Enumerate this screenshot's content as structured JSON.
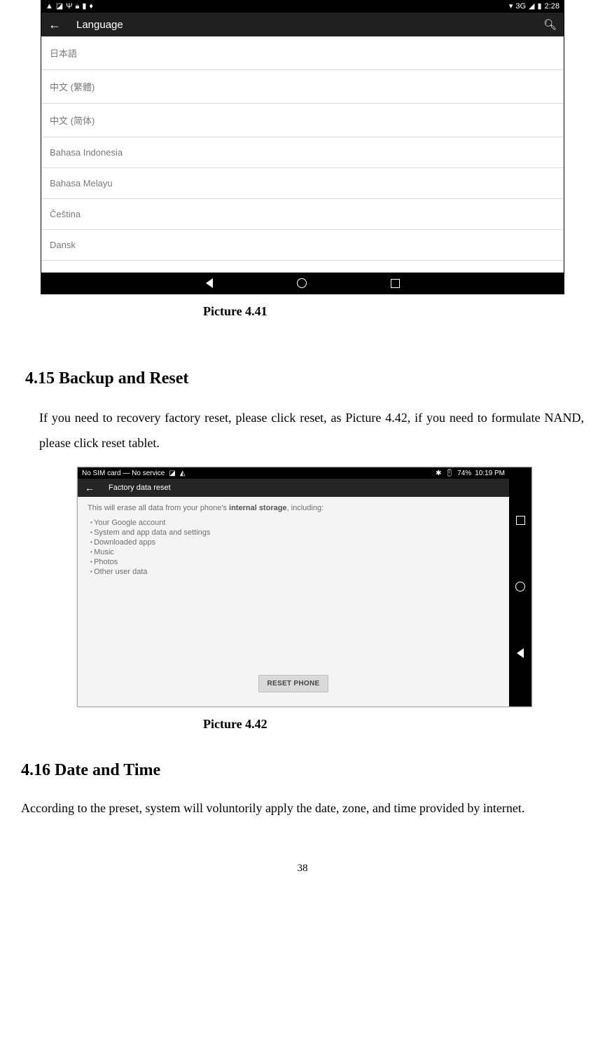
{
  "shot1": {
    "statusbar": {
      "left_icons": [
        "▲",
        "◪",
        "⊍",
        "🔒",
        "≡",
        "♦"
      ],
      "right_text": "3G ◢ ⚡ 2:28",
      "signal_label": "3G"
    },
    "appbar": {
      "title": "Language"
    },
    "languages": [
      "日本語",
      "中文 (繁體)",
      "中文 (简体)",
      "Bahasa Indonesia",
      "Bahasa Melayu",
      "Čeština",
      "Dansk"
    ],
    "peek": ""
  },
  "caption1": "Picture 4.41",
  "section415": {
    "heading": "4.15  Backup and Reset",
    "body": "If you need to recovery factory reset, please click reset, as Picture 4.42, if you need to formulate NAND, please click reset tablet."
  },
  "shot2": {
    "statusbar": {
      "left": "No SIM card — No service",
      "right": "✱  🔋 74%  10:19 PM",
      "battery": "74%",
      "time": "10:19 PM"
    },
    "appbar": {
      "title": "Factory data reset"
    },
    "intro_pre": "This will erase all data from your phone's ",
    "intro_strong": "internal storage",
    "intro_post": ", including:",
    "bullets": [
      "Your Google account",
      "System and app data and settings",
      "Downloaded apps",
      "Music",
      "Photos",
      "Other user data"
    ],
    "button": "RESET PHONE"
  },
  "caption2": "Picture 4.42",
  "section416": {
    "heading": "4.16 Date and Time",
    "body": "According to the preset, system will voluntorily apply the date, zone, and time provided by internet."
  },
  "page_number": "38"
}
